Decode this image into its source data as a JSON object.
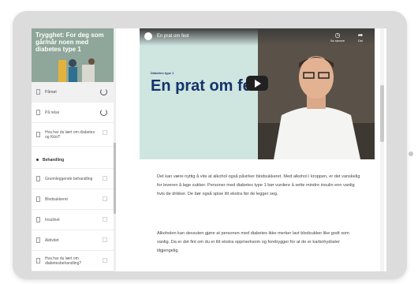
{
  "sidebar": {
    "hero_title": "Trygghet: For deg som går/når noen med diabetes type 1",
    "items": [
      {
        "label": "Påmøt",
        "status": "progress",
        "active": true
      },
      {
        "label": "På reise",
        "status": "progress",
        "active": false
      },
      {
        "label": "Hva har du lært om diabetes og Kitol?",
        "status": "box",
        "active": false
      }
    ],
    "section_label": "Behandling",
    "sub_items": [
      {
        "label": "Grunnleggende behandling"
      },
      {
        "label": "Blodsukkeret"
      },
      {
        "label": "Insulinet"
      },
      {
        "label": "Aktivitet"
      },
      {
        "label": "Hva har du lært om diabetesbehandling?"
      }
    ]
  },
  "video": {
    "title": "En prat om fest",
    "kicker": "Diabetes type 1",
    "heading": "En prat om fest",
    "watch_later_label": "Se senere",
    "share_label": "Del"
  },
  "content": {
    "paragraph1": "Det kan være nyttig å vite at alkohol også påvirker blodsukkeret. Med alkohol i kroppen, er det vanskelig for leveren å lage sukker. Personer med diabetes type 1 bør vurdere å sette mindre insulin enn vanlig hvis de drikker. De bør også spise litt ekstra før de legger seg.",
    "paragraph2": "Alkoholen kan dessuten gjøre at personen med diabetes ikke merker lavt blodsukker like godt som vanlig. Da er det fint om du er litt ekstra oppmerksom og forebygger for at de er karbohydrater tilgjengelig."
  },
  "colors": {
    "hero_bg": "#8fa69a",
    "heading_blue": "#14336a",
    "video_bg": "#cfe5e0"
  }
}
